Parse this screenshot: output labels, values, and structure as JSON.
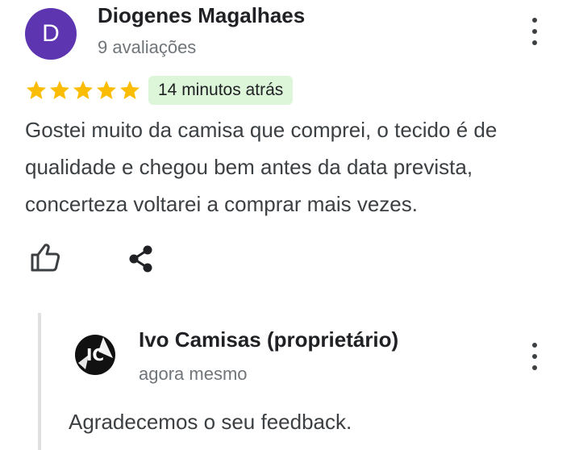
{
  "review": {
    "author_initial": "D",
    "author_name": "Diogenes Magalhaes",
    "author_meta": "9 avaliações",
    "rating": 5,
    "rating_max": 5,
    "time_ago": "14 minutos atrás",
    "text": "Gostei muito da camisa que comprei, o tecido é de qualidade e chegou bem antes da data prevista, concerteza voltarei a comprar mais vezes.",
    "menu_icon": "more-vert-icon",
    "like_icon": "thumb-up-outline-icon",
    "share_icon": "share-icon"
  },
  "owner_reply": {
    "logo_text": "IC",
    "name": "Ivo Camisas (proprietário)",
    "meta": "agora mesmo",
    "text": "Agradecemos o seu feedback.",
    "menu_icon": "more-vert-icon"
  },
  "colors": {
    "avatar_bg": "#5e35b1",
    "star": "#fbbc04",
    "time_badge_bg": "#ddf5d9",
    "reply_bar": "#e0e0e0"
  }
}
